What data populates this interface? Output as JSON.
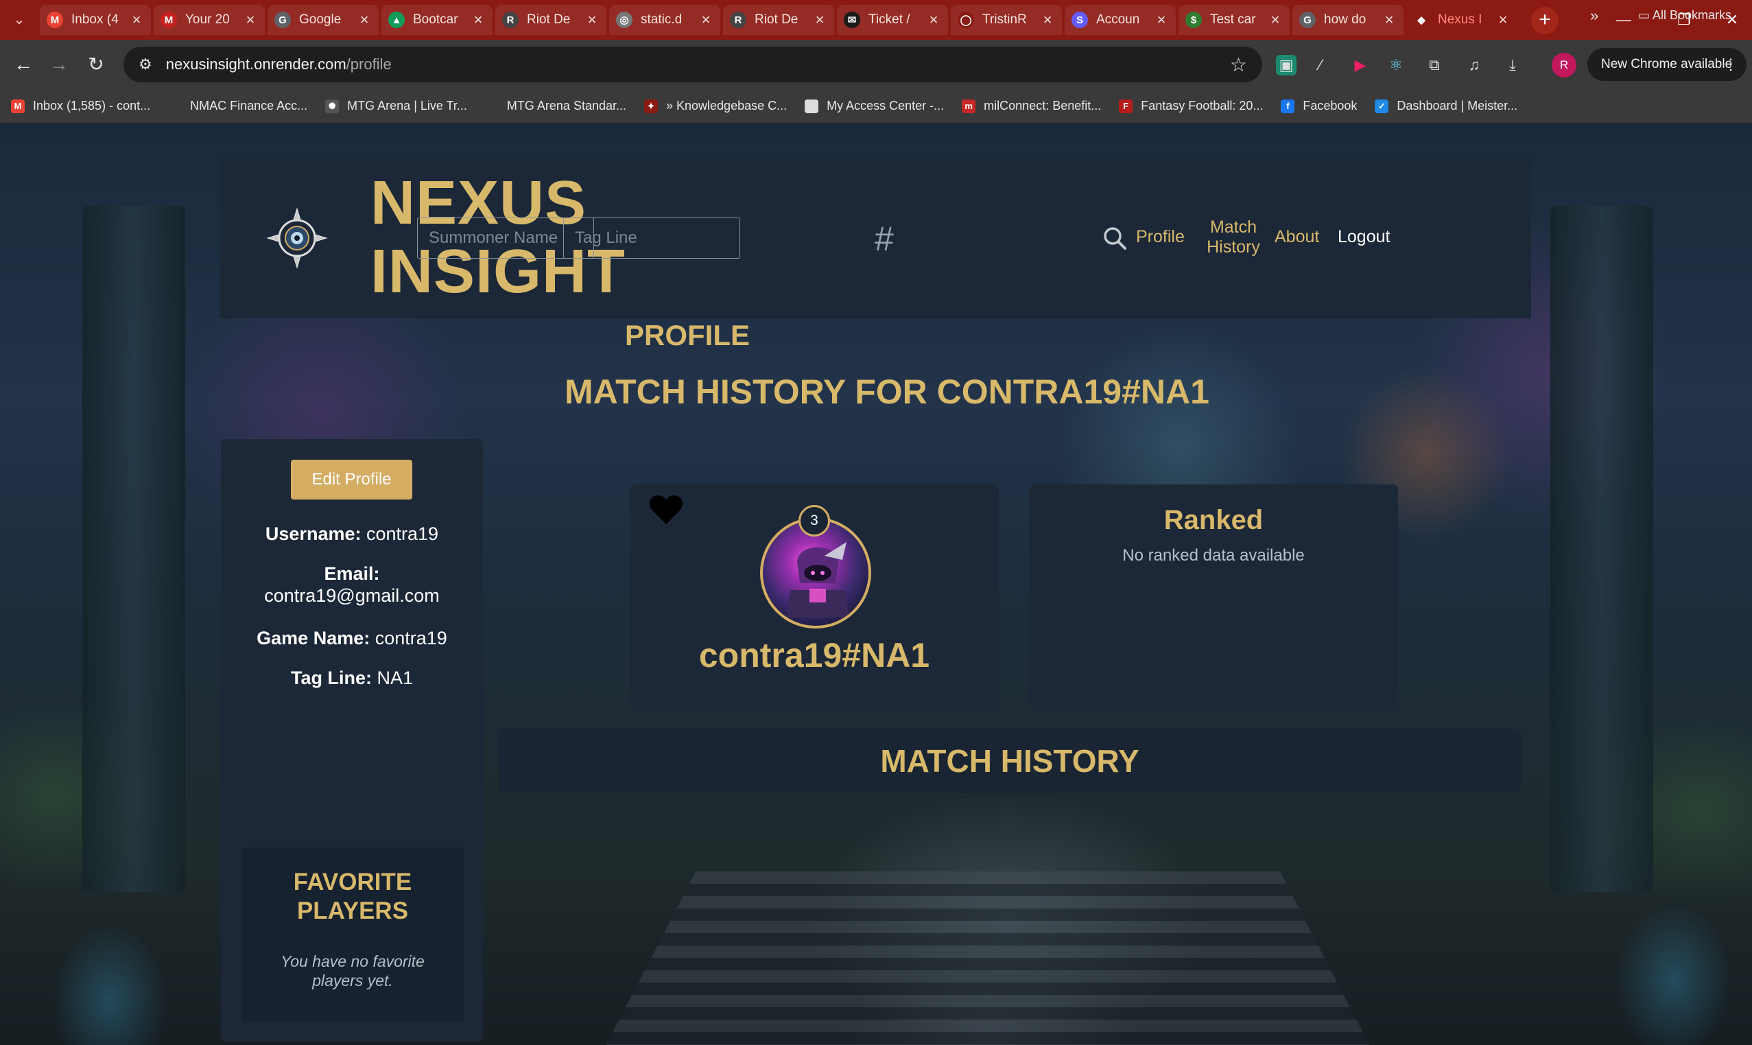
{
  "browser": {
    "tabs": [
      {
        "title": "Inbox (4",
        "favicon": "gmail-icon",
        "color": "#ea4335",
        "glyph": "M"
      },
      {
        "title": "Your 20",
        "favicon": "gmail-icon",
        "color": "#c5221f",
        "glyph": "M"
      },
      {
        "title": "Google",
        "favicon": "google-icon",
        "color": "#5f6368",
        "glyph": "G"
      },
      {
        "title": "Bootcar",
        "favicon": "drive-icon",
        "color": "#0f9d58",
        "glyph": "▲"
      },
      {
        "title": "Riot De",
        "favicon": "riot-icon",
        "color": "#444",
        "glyph": "R"
      },
      {
        "title": "static.d",
        "favicon": "globe-icon",
        "color": "#777",
        "glyph": "◎"
      },
      {
        "title": "Riot De",
        "favicon": "riot-icon",
        "color": "#444",
        "glyph": "R"
      },
      {
        "title": "Ticket /",
        "favicon": "ticket-icon",
        "color": "#1a1a1a",
        "glyph": "✉"
      },
      {
        "title": "TristinR",
        "favicon": "github-icon",
        "color": "#8b1a12",
        "glyph": "◯"
      },
      {
        "title": "Accoun",
        "favicon": "stripe-icon",
        "color": "#635bff",
        "glyph": "S"
      },
      {
        "title": "Test car",
        "favicon": "dollar-icon",
        "color": "#2e7d32",
        "glyph": "$"
      },
      {
        "title": "how do",
        "favicon": "google-icon",
        "color": "#5f6368",
        "glyph": "G"
      },
      {
        "title": "Nexus I",
        "favicon": "nexus-icon",
        "color": "#8b1a12",
        "glyph": "◆",
        "active": true
      }
    ],
    "url_host": "nexusinsight.onrender.com",
    "url_path": "/profile",
    "update_label": "New Chrome available",
    "profile_initial": "R",
    "bookmarks": [
      {
        "label": "Inbox (1,585) - cont...",
        "icon": "gmail-icon",
        "color": "#ea4335",
        "glyph": "M"
      },
      {
        "label": "NMAC Finance Acc...",
        "icon": "blank-icon",
        "color": "#3a3a3a",
        "glyph": ""
      },
      {
        "label": "MTG Arena | Live Tr...",
        "icon": "mtg-icon",
        "color": "#555",
        "glyph": "✺"
      },
      {
        "label": "MTG Arena Standar...",
        "icon": "blank-icon",
        "color": "#3a3a3a",
        "glyph": ""
      },
      {
        "label": "» Knowledgebase C...",
        "icon": "kb-icon",
        "color": "#8b1a12",
        "glyph": "✦"
      },
      {
        "label": "My Access Center -...",
        "icon": "doc-icon",
        "color": "#ddd",
        "glyph": ""
      },
      {
        "label": "milConnect: Benefit...",
        "icon": "mil-icon",
        "color": "#c62828",
        "glyph": "m"
      },
      {
        "label": "Fantasy Football: 20...",
        "icon": "espn-icon",
        "color": "#b71c1c",
        "glyph": "F"
      },
      {
        "label": "Facebook",
        "icon": "facebook-icon",
        "color": "#1877f2",
        "glyph": "f"
      },
      {
        "label": "Dashboard | Meister...",
        "icon": "check-icon",
        "color": "#1e88e5",
        "glyph": "✓"
      }
    ],
    "bookmarks_more": "»",
    "all_bookmarks": "All Bookmarks"
  },
  "header": {
    "brand": "NEXUS INSIGHT",
    "summoner_placeholder": "Summoner Name",
    "hash": "#",
    "tagline_placeholder": "Tag Line",
    "nav": {
      "profile": "Profile",
      "match_history": "Match History",
      "about": "About",
      "logout": "Logout"
    }
  },
  "page": {
    "heading": "PROFILE",
    "match_heading": "MATCH HISTORY FOR CONTRA19#NA1"
  },
  "sidebar": {
    "edit_button": "Edit Profile",
    "username_label": "Username:",
    "username": "contra19",
    "email_label": "Email:",
    "email": "contra19@gmail.com",
    "game_name_label": "Game Name:",
    "game_name": "contra19",
    "tag_line_label": "Tag Line:",
    "tag_line": "NA1",
    "favorites_title": "FAVORITE PLAYERS",
    "favorites_empty": "You have no favorite players yet."
  },
  "profile_card": {
    "level": "3",
    "riot_id": "contra19#NA1"
  },
  "ranked": {
    "title": "Ranked",
    "empty": "No ranked data available"
  },
  "match_history": {
    "title": "MATCH HISTORY"
  },
  "colors": {
    "gold": "#d8b86a",
    "panel": "#1c2837",
    "tabstrip": "#8b1a12"
  }
}
